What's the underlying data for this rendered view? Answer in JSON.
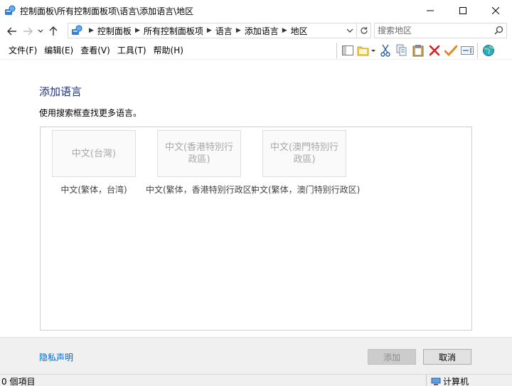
{
  "window": {
    "title": "控制面板\\所有控制面板项\\语言\\添加语言\\地区"
  },
  "address": {
    "crumbs": [
      "控制面板",
      "所有控制面板项",
      "语言",
      "添加语言",
      "地区"
    ],
    "search_placeholder": "搜索地区"
  },
  "menu": {
    "items": [
      "文件(F)",
      "编辑(E)",
      "查看(V)",
      "工具(T)",
      "帮助(H)"
    ]
  },
  "main": {
    "title": "添加语言",
    "instruction": "使用搜索框查找更多语言。",
    "regions": [
      {
        "label": "中文(台灣)",
        "caption": "中文(繁体，台湾)"
      },
      {
        "label": "中文(香港特別行政區)",
        "caption": "中文(繁体，香港特别行政区)"
      },
      {
        "label": "中文(澳門特別行政區)",
        "caption": "中文(繁体，澳门特别行政区)"
      }
    ]
  },
  "footer": {
    "privacy_label": "隐私声明",
    "add_label": "添加",
    "cancel_label": "取消"
  },
  "status": {
    "item_count": "0 個項目",
    "computer_label": "计算机"
  },
  "colors": {
    "title_blue": "#1e3287",
    "link_blue": "#0066cc",
    "delete_red": "#d81e1e",
    "check_orange": "#e8821e"
  }
}
